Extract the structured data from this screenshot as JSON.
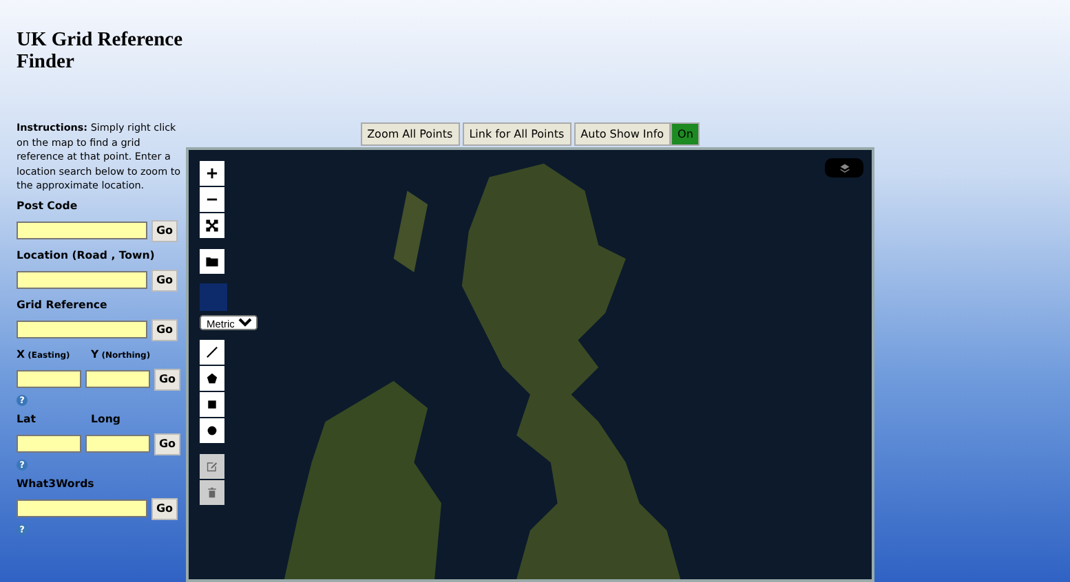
{
  "title": "UK Grid Reference Finder",
  "instructions": {
    "lead": "Instructions:",
    "text": "Simply right click on the map to find a grid reference at that point. Enter a location search below to zoom to the approximate location."
  },
  "search_rows": [
    {
      "kind": "single",
      "label": "Post Code",
      "button": "Go"
    },
    {
      "kind": "single",
      "label": "Location (Road , Town)",
      "button": "Go"
    },
    {
      "kind": "single",
      "label": "Grid Reference",
      "button": "Go"
    },
    {
      "kind": "pair",
      "labels": [
        {
          "text": "X",
          "note": "(Easting)"
        },
        {
          "text": "Y",
          "note": "(Northing)"
        }
      ],
      "button": "Go",
      "help": "?"
    },
    {
      "kind": "pair",
      "labels": [
        {
          "text": "Lat"
        },
        {
          "text": "Long"
        }
      ],
      "button": "Go",
      "help": "?"
    },
    {
      "kind": "single",
      "label": "What3Words",
      "button": "Go",
      "help": "?"
    }
  ],
  "toolbar": {
    "buttons": [
      "Zoom All Points",
      "Link for All Points",
      "Auto Show Info"
    ],
    "toggle": {
      "label": "On",
      "on": true
    }
  },
  "map": {
    "units": "Metric",
    "controls": [
      {
        "kind": "zoom-in",
        "disabled": false
      },
      {
        "kind": "zoom-out",
        "disabled": false
      },
      {
        "kind": "fullscreen",
        "disabled": false
      },
      {
        "kind": "gap"
      },
      {
        "kind": "folder",
        "disabled": false
      },
      {
        "kind": "swatch"
      },
      {
        "kind": "units"
      },
      {
        "kind": "line",
        "disabled": false
      },
      {
        "kind": "polygon",
        "disabled": false
      },
      {
        "kind": "square",
        "disabled": false
      },
      {
        "kind": "circle",
        "disabled": false
      },
      {
        "kind": "gap"
      },
      {
        "kind": "edit",
        "disabled": true
      },
      {
        "kind": "delete",
        "disabled": true
      }
    ]
  }
}
